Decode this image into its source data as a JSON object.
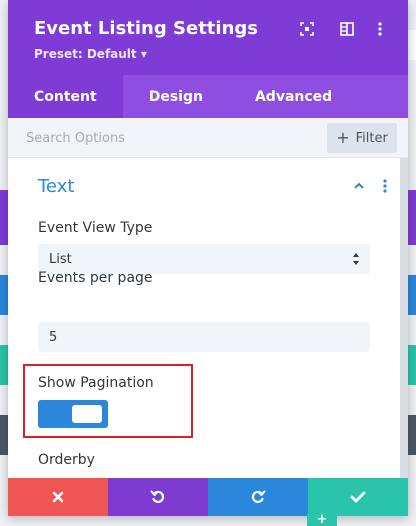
{
  "modal": {
    "title": "Event Listing Settings",
    "preset": "Preset: Default",
    "preset_arrow": "▾",
    "header_icons": [
      "screen-reset-icon",
      "sidebar-toggle-icon",
      "more-vertical-icon"
    ]
  },
  "tabs": [
    {
      "label": "Content",
      "active": true
    },
    {
      "label": "Design",
      "active": false
    },
    {
      "label": "Advanced",
      "active": false
    }
  ],
  "search": {
    "placeholder": "Search Options",
    "value": ""
  },
  "filter": {
    "label": "Filter",
    "icon": "plus-icon"
  },
  "section": {
    "title": "Text"
  },
  "fields": {
    "event_view_type": {
      "label": "Event View Type",
      "value": "List"
    },
    "events_per_page": {
      "label": "Events per page",
      "value": "5"
    },
    "show_pagination": {
      "label": "Show Pagination",
      "value": "on"
    },
    "orderby": {
      "label": "Orderby"
    }
  },
  "footer": {
    "buttons": [
      {
        "name": "discard",
        "icon": "close-icon",
        "color": "#ef5555"
      },
      {
        "name": "undo",
        "icon": "undo-icon",
        "color": "#7e3bd0"
      },
      {
        "name": "redo",
        "icon": "redo-icon",
        "color": "#2b87da"
      },
      {
        "name": "save",
        "icon": "check-icon",
        "color": "#29c4a9"
      }
    ],
    "add_label": "+"
  },
  "colors": {
    "header": "#7f3bd6",
    "tabs": "#8e4ee0",
    "accent_blue": "#2b87da",
    "highlight_red": "#d9202d"
  }
}
